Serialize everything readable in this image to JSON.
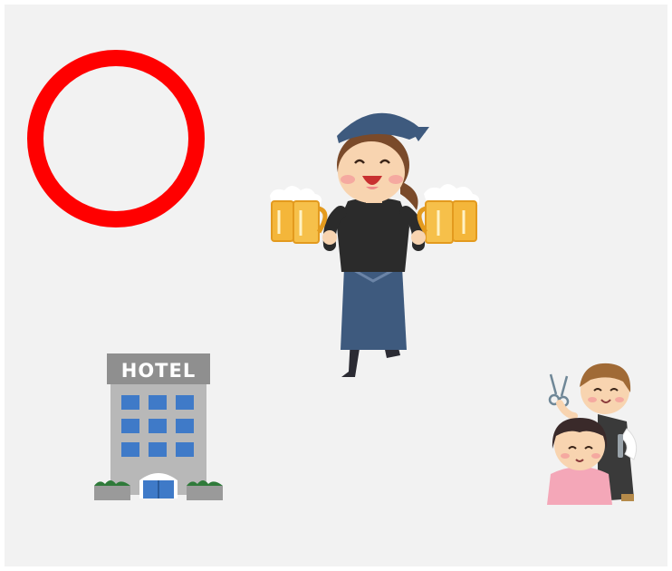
{
  "canvas": {
    "background": "#f2f2f2"
  },
  "symbols": {
    "circle": {
      "icon": "red-circle-icon",
      "color": "#ff0000"
    },
    "waitress": {
      "icon": "izakaya-waitress-beer-icon"
    },
    "hotel": {
      "icon": "hotel-building-icon",
      "sign_text": "HOTEL"
    },
    "barber": {
      "icon": "hairdresser-cutting-hair-icon"
    }
  }
}
